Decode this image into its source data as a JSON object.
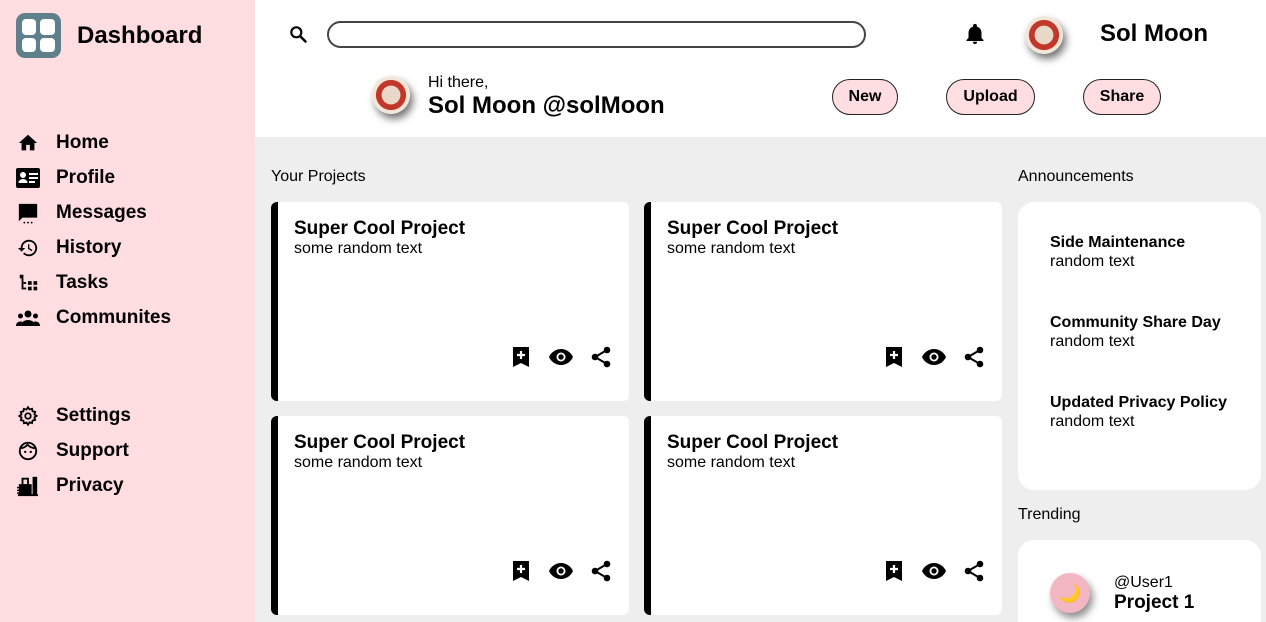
{
  "brand": {
    "title": "Dashboard",
    "icon": "dashboard-grid-icon",
    "color": "#5f7f8b"
  },
  "sidebar": {
    "background": "#ffdde1",
    "primary": [
      {
        "label": "Home",
        "icon": "home-icon"
      },
      {
        "label": "Profile",
        "icon": "profile-card-icon"
      },
      {
        "label": "Messages",
        "icon": "message-icon"
      },
      {
        "label": "History",
        "icon": "history-icon"
      },
      {
        "label": "Tasks",
        "icon": "tasks-icon"
      },
      {
        "label": "Communites",
        "icon": "people-icon"
      }
    ],
    "secondary": [
      {
        "label": "Settings",
        "icon": "gear-icon"
      },
      {
        "label": "Support",
        "icon": "support-face-icon"
      },
      {
        "label": "Privacy",
        "icon": "privacy-lock-icon"
      }
    ]
  },
  "header": {
    "search": {
      "value": "",
      "placeholder": "",
      "icon": "search-icon"
    },
    "notification_icon": "bell-icon",
    "user_name": "Sol Moon",
    "greeting_small": "Hi there,",
    "greeting_name": "Sol Moon @solMoon",
    "actions": {
      "new": "New",
      "upload": "Upload",
      "share": "Share"
    }
  },
  "projects": {
    "heading": "Your Projects",
    "items": [
      {
        "title": "Super Cool Project",
        "subtitle": "some random text"
      },
      {
        "title": "Super Cool Project",
        "subtitle": "some random text"
      },
      {
        "title": "Super Cool Project",
        "subtitle": "some random text"
      },
      {
        "title": "Super Cool Project",
        "subtitle": "some random text"
      }
    ],
    "action_icons": [
      "bookmark-add-icon",
      "eye-icon",
      "share-icon"
    ]
  },
  "announcements": {
    "heading": "Announcements",
    "items": [
      {
        "title": "Side Maintenance",
        "body": "random text"
      },
      {
        "title": "Community Share Day",
        "body": "random text"
      },
      {
        "title": "Updated Privacy Policy",
        "body": "random text"
      }
    ]
  },
  "trending": {
    "heading": "Trending",
    "items": [
      {
        "user": "@User1",
        "project": "Project 1",
        "avatar_icon": "moon-icon"
      }
    ]
  },
  "colors": {
    "accent_pink": "#ffdde1",
    "main_bg": "#eeeeee",
    "text": "#000000"
  }
}
